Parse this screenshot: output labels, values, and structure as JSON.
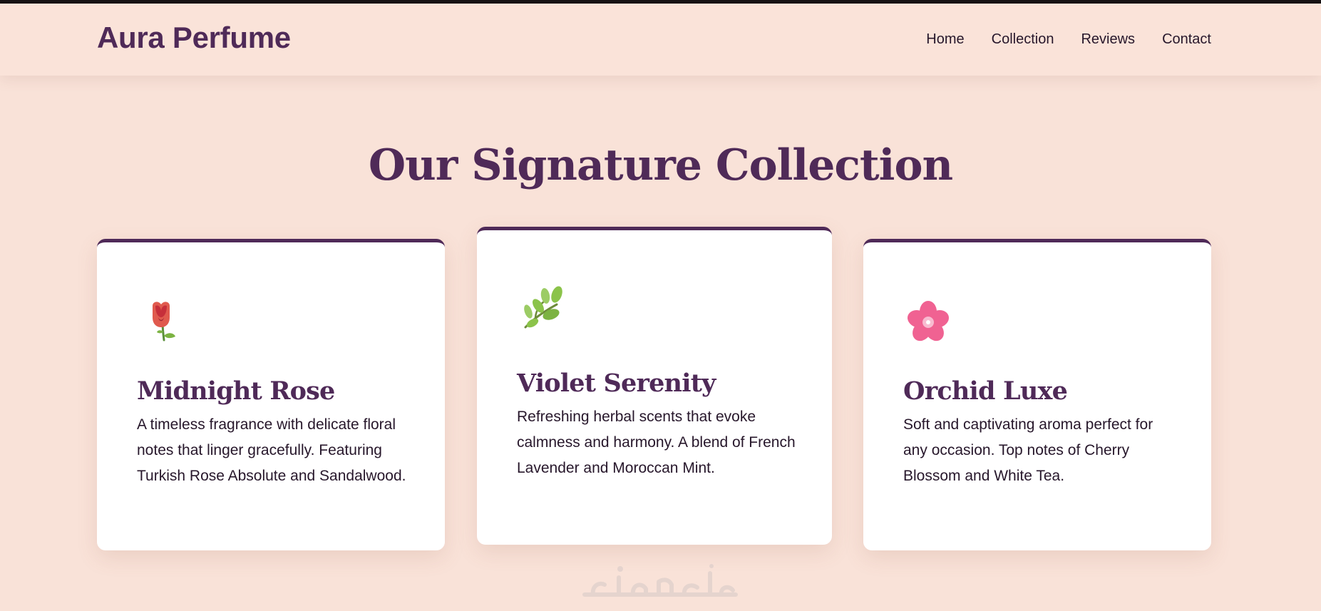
{
  "header": {
    "brand": "Aura Perfume",
    "nav": [
      "Home",
      "Collection",
      "Reviews",
      "Contact"
    ]
  },
  "collection": {
    "title": "Our Signature Collection",
    "cards": [
      {
        "name": "Midnight Rose",
        "description": "A timeless fragrance with delicate floral notes that linger gracefully. Featuring Turkish Rose Absolute and Sandalwood.",
        "icon": "rose-icon"
      },
      {
        "name": "Violet Serenity",
        "description": "Refreshing herbal scents that evoke calmness and harmony. A blend of French Lavender and Moroccan Mint.",
        "icon": "herb-icon"
      },
      {
        "name": "Orchid Luxe",
        "description": "Soft and captivating aroma perfect for any occasion. Top notes of Cherry Blossom and White Tea.",
        "icon": "cherry-blossom-icon"
      }
    ]
  },
  "watermark": {
    "text": "خمسات",
    "icon": "khamsat-watermark-logo"
  },
  "colors": {
    "background": "#f9e2d8",
    "header_background": "#fae3d9",
    "brand": "#4f2a58",
    "text": "#27172b",
    "card_background": "#ffffff",
    "card_accent": "#4f2a58"
  }
}
